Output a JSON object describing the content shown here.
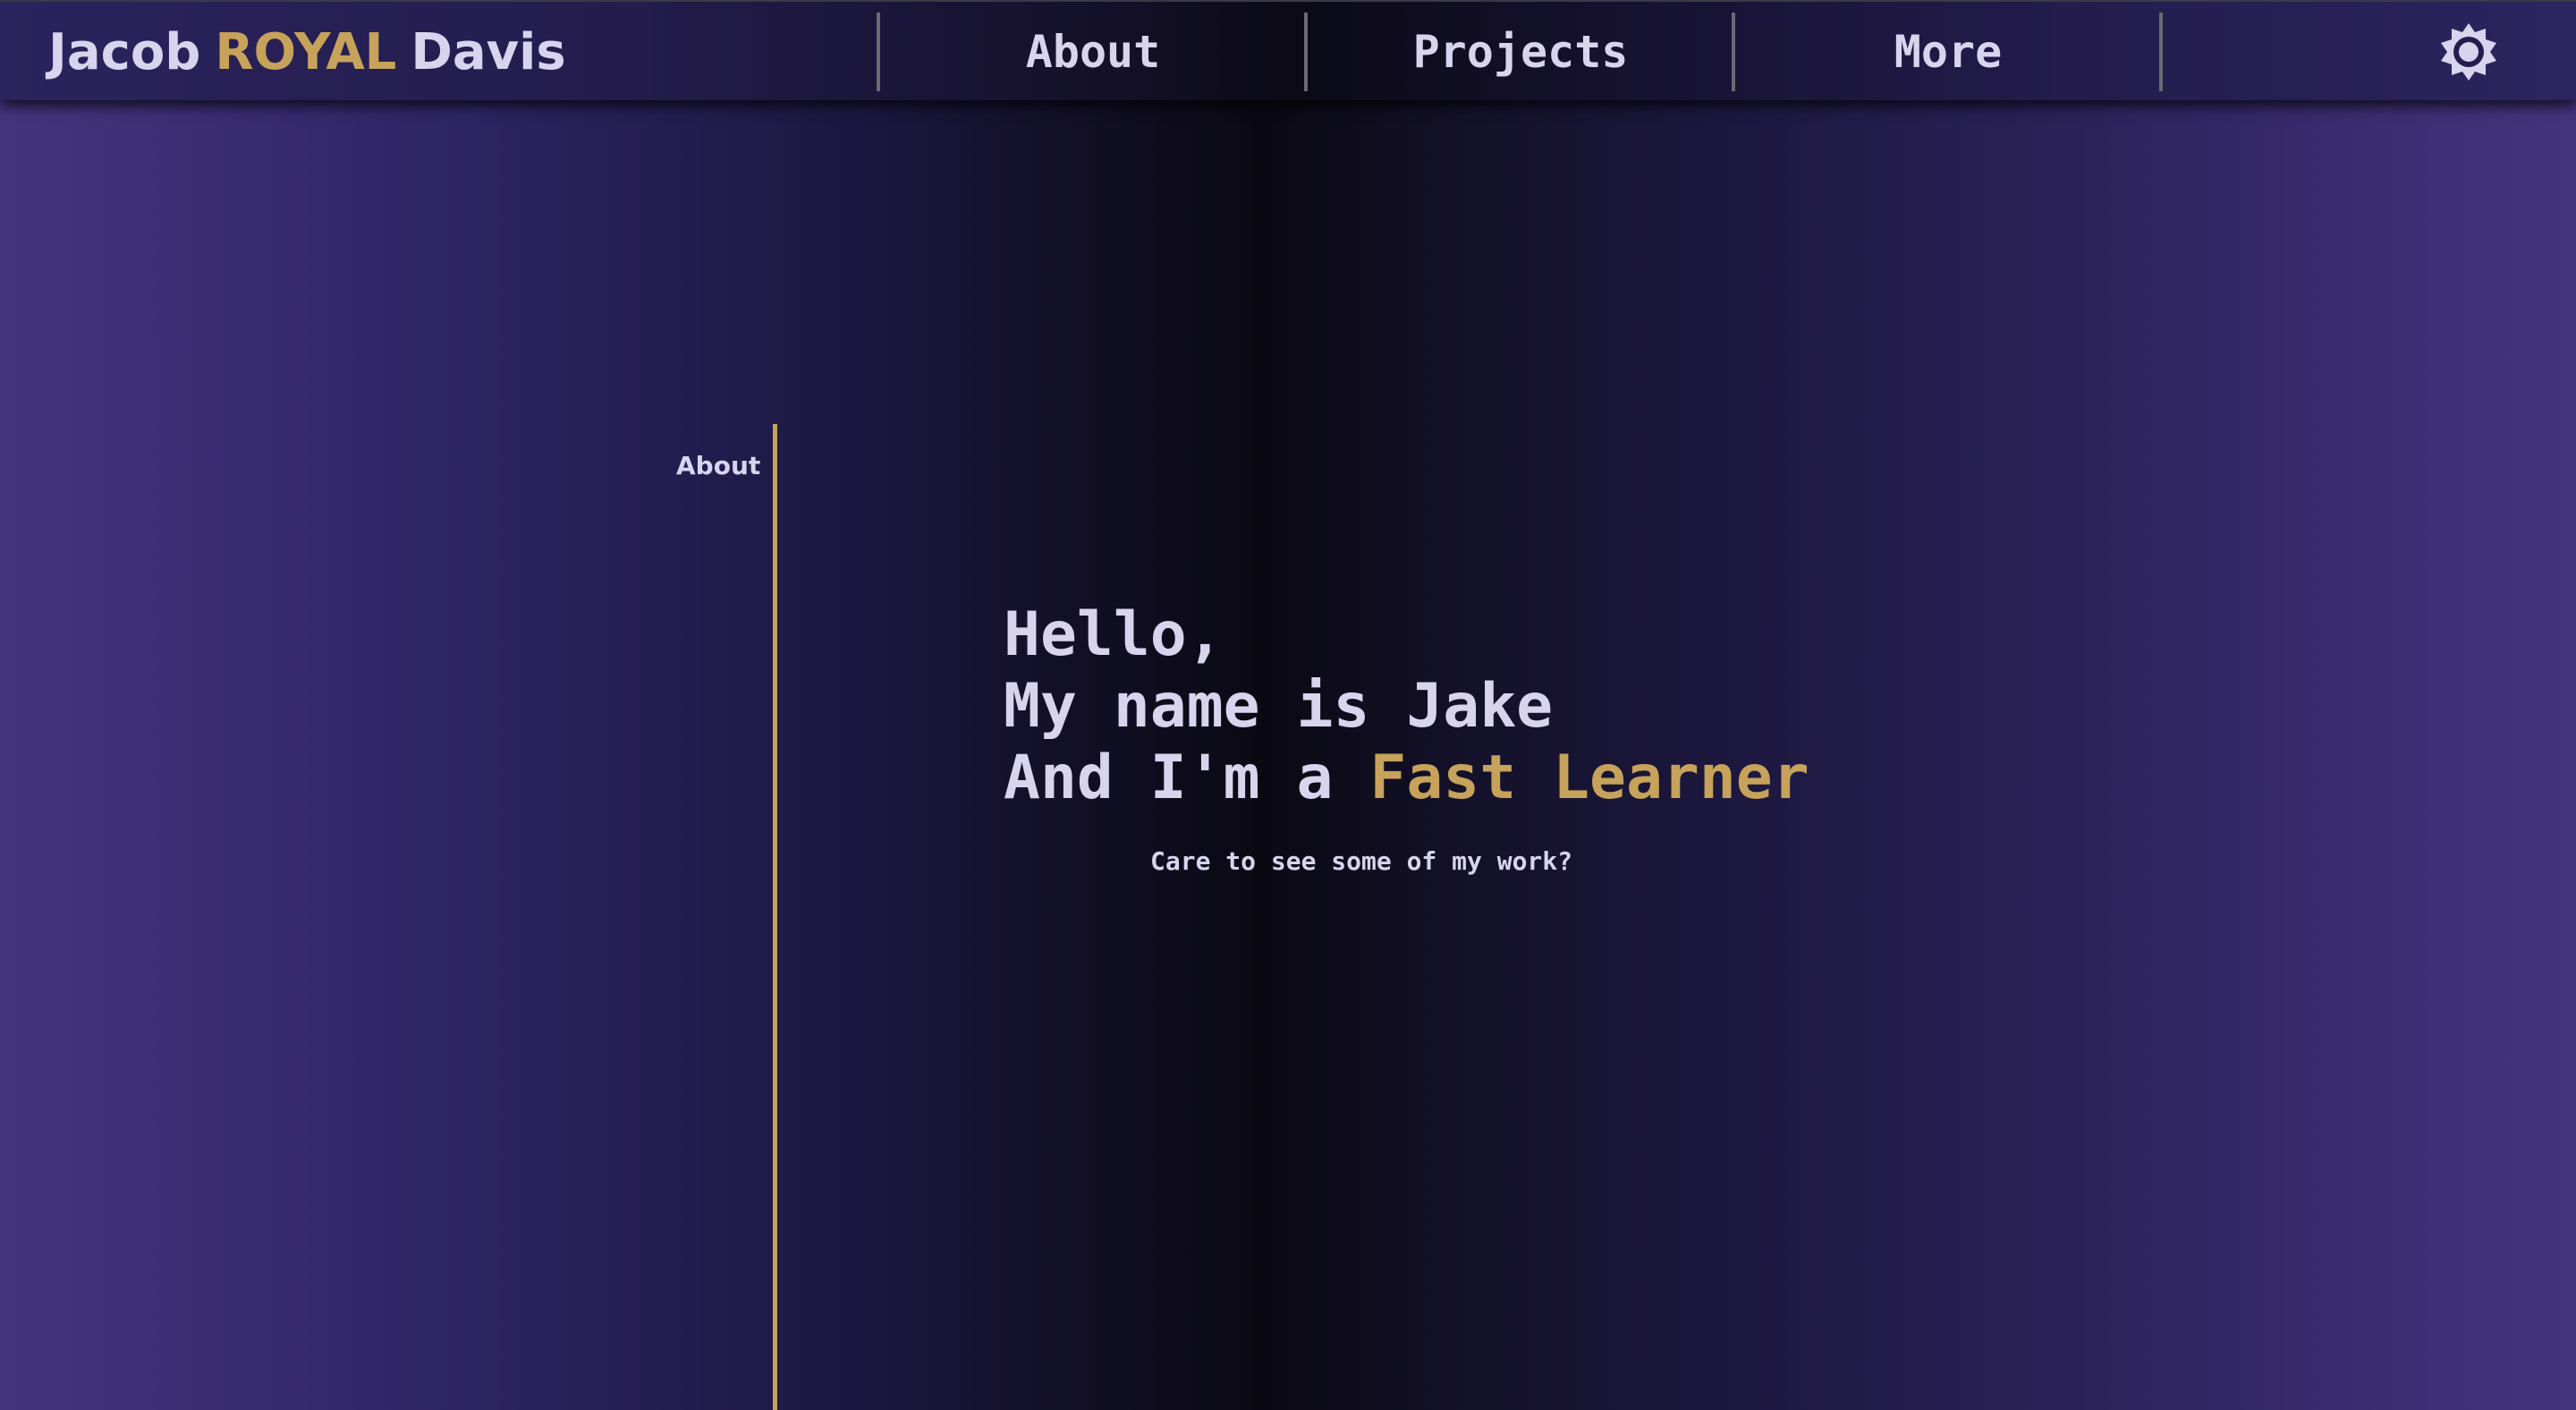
{
  "header": {
    "brand": {
      "first": "Jacob",
      "middle": "ROYAL",
      "last": "Davis"
    },
    "nav": [
      {
        "label": "About"
      },
      {
        "label": "Projects"
      },
      {
        "label": "More"
      }
    ],
    "settings_icon": "gear-icon"
  },
  "section": {
    "label": "About"
  },
  "hero": {
    "line1": "Hello,",
    "line2": "My name is Jake",
    "line3_prefix": "And I'm a ",
    "line3_highlight": "Fast Learner",
    "cta": "Care to see some of my work?"
  },
  "colors": {
    "accent_gold": "#c6a25a",
    "text": "#d8d4ee",
    "purple": "#44347e",
    "dark": "#0a0912"
  }
}
